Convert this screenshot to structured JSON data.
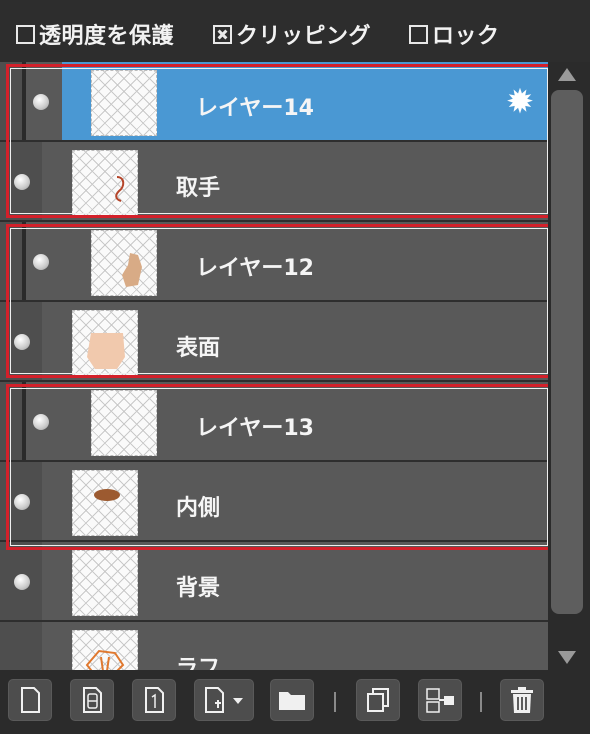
{
  "options": {
    "protect_alpha": {
      "label": "透明度を保護",
      "checked": false
    },
    "clipping": {
      "label": "クリッピング",
      "checked": true
    },
    "lock": {
      "label": "ロック",
      "checked": false
    }
  },
  "layers": [
    {
      "name": "レイヤー14",
      "selected": true,
      "clipping": true,
      "has_settings_icon": true
    },
    {
      "name": "取手",
      "selected": false,
      "clipping": false
    },
    {
      "name": "レイヤー12",
      "selected": false,
      "clipping": true
    },
    {
      "name": "表面",
      "selected": false,
      "clipping": false
    },
    {
      "name": "レイヤー13",
      "selected": false,
      "clipping": true
    },
    {
      "name": "内側",
      "selected": false,
      "clipping": false
    },
    {
      "name": "背景",
      "selected": false,
      "clipping": false
    },
    {
      "name": "ラフ",
      "selected": false,
      "clipping": false
    }
  ],
  "colors": {
    "selection": "#4a98d3",
    "group_outline": "#d3202a",
    "row_bg": "#595959"
  },
  "toolbar": {
    "icons": [
      "new-layer-icon",
      "new-8bit-layer-icon",
      "new-1bit-layer-icon",
      "add-special-layer-icon",
      "new-folder-icon",
      "duplicate-layer-icon",
      "merge-down-icon",
      "delete-layer-icon"
    ]
  }
}
